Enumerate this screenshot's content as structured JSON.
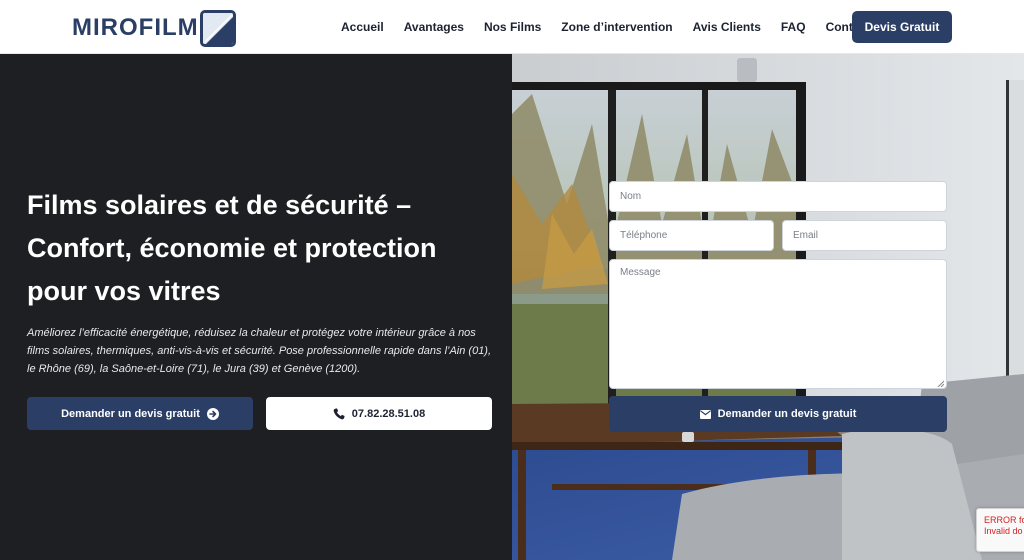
{
  "header": {
    "logo_text": "MIROFILM",
    "nav": [
      "Accueil",
      "Avantages",
      "Nos Films",
      "Zone d’intervention",
      "Avis Clients",
      "FAQ",
      "Contact"
    ],
    "cta_label": "Devis Gratuit"
  },
  "hero": {
    "headline": "Films solaires et de sécurité – Confort, économie et protection pour vos vitres",
    "subtext": "Améliorez l’efficacité énergétique, réduisez la chaleur et protégez votre intérieur grâce à nos films solaires, thermiques, anti-vis-à-vis et sécurité. Pose professionnelle rapide dans l’Ain (01), le Rhône (69), la Saône-et-Loire (71), le Jura (39) et Genève (1200).",
    "primary_button": "Demander un devis gratuit",
    "phone_button": "07.82.28.51.08"
  },
  "form": {
    "name_placeholder": "Nom",
    "phone_placeholder": "Téléphone",
    "email_placeholder": "Email",
    "message_placeholder": "Message",
    "submit_label": "Demander un devis gratuit"
  },
  "recaptcha": {
    "line1": "ERROR fo",
    "line2": "Invalid do"
  },
  "colors": {
    "brand": "#2b3f66",
    "dark_panel": "#1e1f22",
    "error": "#d42020"
  },
  "icons": {
    "logo": "window-film-logo-icon",
    "primary_button": "arrow-circle-right-icon",
    "phone_button": "phone-icon",
    "submit": "envelope-icon"
  }
}
